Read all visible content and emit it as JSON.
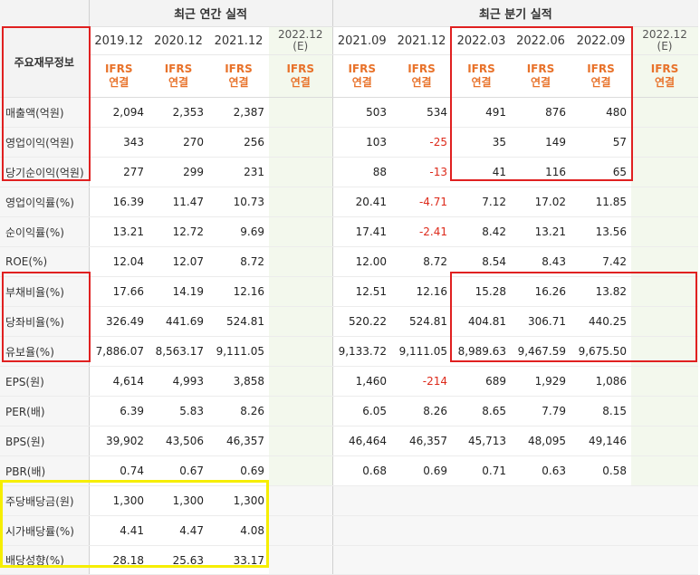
{
  "groups": {
    "annual": "최근 연간 실적",
    "quarterly": "최근 분기 실적"
  },
  "row_header": "주요재무정보",
  "periods": [
    {
      "label": "2019.12",
      "ifrs1": "IFRS",
      "ifrs2": "연결"
    },
    {
      "label": "2020.12",
      "ifrs1": "IFRS",
      "ifrs2": "연결"
    },
    {
      "label": "2021.12",
      "ifrs1": "IFRS",
      "ifrs2": "연결"
    },
    {
      "label": "2022.12",
      "sub": "(E)",
      "ifrs1": "IFRS",
      "ifrs2": "연결",
      "estimate": true
    },
    {
      "label": "2021.09",
      "ifrs1": "IFRS",
      "ifrs2": "연결"
    },
    {
      "label": "2021.12",
      "ifrs1": "IFRS",
      "ifrs2": "연결"
    },
    {
      "label": "2022.03",
      "ifrs1": "IFRS",
      "ifrs2": "연결"
    },
    {
      "label": "2022.06",
      "ifrs1": "IFRS",
      "ifrs2": "연결"
    },
    {
      "label": "2022.09",
      "ifrs1": "IFRS",
      "ifrs2": "연결"
    },
    {
      "label": "2022.12",
      "sub": "(E)",
      "ifrs1": "IFRS",
      "ifrs2": "연결",
      "estimate": true
    }
  ],
  "rows": [
    {
      "label": "매출액(억원)",
      "values": [
        "2,094",
        "2,353",
        "2,387",
        "",
        "503",
        "534",
        "491",
        "876",
        "480",
        ""
      ]
    },
    {
      "label": "영업이익(억원)",
      "values": [
        "343",
        "270",
        "256",
        "",
        "103",
        "-25",
        "35",
        "149",
        "57",
        ""
      ]
    },
    {
      "label": "당기순이익(억원)",
      "values": [
        "277",
        "299",
        "231",
        "",
        "88",
        "-13",
        "41",
        "116",
        "65",
        ""
      ]
    },
    {
      "label": "영업이익률(%)",
      "values": [
        "16.39",
        "11.47",
        "10.73",
        "",
        "20.41",
        "-4.71",
        "7.12",
        "17.02",
        "11.85",
        ""
      ]
    },
    {
      "label": "순이익률(%)",
      "values": [
        "13.21",
        "12.72",
        "9.69",
        "",
        "17.41",
        "-2.41",
        "8.42",
        "13.21",
        "13.56",
        ""
      ]
    },
    {
      "label": "ROE(%)",
      "values": [
        "12.04",
        "12.07",
        "8.72",
        "",
        "12.00",
        "8.72",
        "8.54",
        "8.43",
        "7.42",
        ""
      ]
    },
    {
      "label": "부채비율(%)",
      "values": [
        "17.66",
        "14.19",
        "12.16",
        "",
        "12.51",
        "12.16",
        "15.28",
        "16.26",
        "13.82",
        ""
      ]
    },
    {
      "label": "당좌비율(%)",
      "values": [
        "326.49",
        "441.69",
        "524.81",
        "",
        "520.22",
        "524.81",
        "404.81",
        "306.71",
        "440.25",
        ""
      ]
    },
    {
      "label": "유보율(%)",
      "values": [
        "7,886.07",
        "8,563.17",
        "9,111.05",
        "",
        "9,133.72",
        "9,111.05",
        "8,989.63",
        "9,467.59",
        "9,675.50",
        ""
      ]
    },
    {
      "label": "EPS(원)",
      "values": [
        "4,614",
        "4,993",
        "3,858",
        "",
        "1,460",
        "-214",
        "689",
        "1,929",
        "1,086",
        ""
      ]
    },
    {
      "label": "PER(배)",
      "values": [
        "6.39",
        "5.83",
        "8.26",
        "",
        "6.05",
        "8.26",
        "8.65",
        "7.79",
        "8.15",
        ""
      ]
    },
    {
      "label": "BPS(원)",
      "values": [
        "39,902",
        "43,506",
        "46,357",
        "",
        "46,464",
        "46,357",
        "45,713",
        "48,095",
        "49,146",
        ""
      ]
    },
    {
      "label": "PBR(배)",
      "values": [
        "0.74",
        "0.67",
        "0.69",
        "",
        "0.68",
        "0.69",
        "0.71",
        "0.63",
        "0.58",
        ""
      ]
    },
    {
      "label": "주당배당금(원)",
      "values": [
        "1,300",
        "1,300",
        "1,300",
        "",
        "",
        "",
        "",
        "",
        "",
        ""
      ]
    },
    {
      "label": "시가배당률(%)",
      "values": [
        "4.41",
        "4.47",
        "4.08",
        "",
        "",
        "",
        "",
        "",
        "",
        ""
      ]
    },
    {
      "label": "배당성향(%)",
      "values": [
        "28.18",
        "25.63",
        "33.17",
        "",
        "",
        "",
        "",
        "",
        "",
        ""
      ]
    }
  ],
  "colors": {
    "highlight_red": "#e02020",
    "highlight_yellow": "#f6ee00",
    "ifrs": "#e8722a",
    "negative": "#dd2a1b",
    "estimate_bg": "#f3f8ed"
  }
}
